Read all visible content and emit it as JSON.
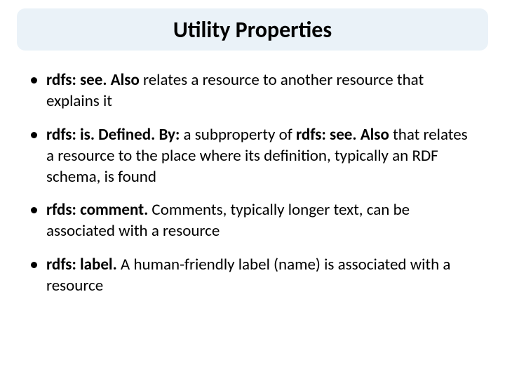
{
  "title": "Utility Properties",
  "items": [
    {
      "bold1": "rdfs: see. Also",
      "text1": " relates a resource to another resource that explains it"
    },
    {
      "bold1": "rdfs: is. Defined. By:",
      "text1": " a subproperty of ",
      "bold2": "rdfs: see. Also",
      "text2": " that relates a resource to the place where its definition, typically an RDF schema, is found"
    },
    {
      "bold1": "rfds: comment.",
      "text1": " Comments, typically longer text, can be associated with a resource"
    },
    {
      "bold1": "rdfs: label.",
      "text1": " A human-friendly label (name) is associated with a resource"
    }
  ]
}
